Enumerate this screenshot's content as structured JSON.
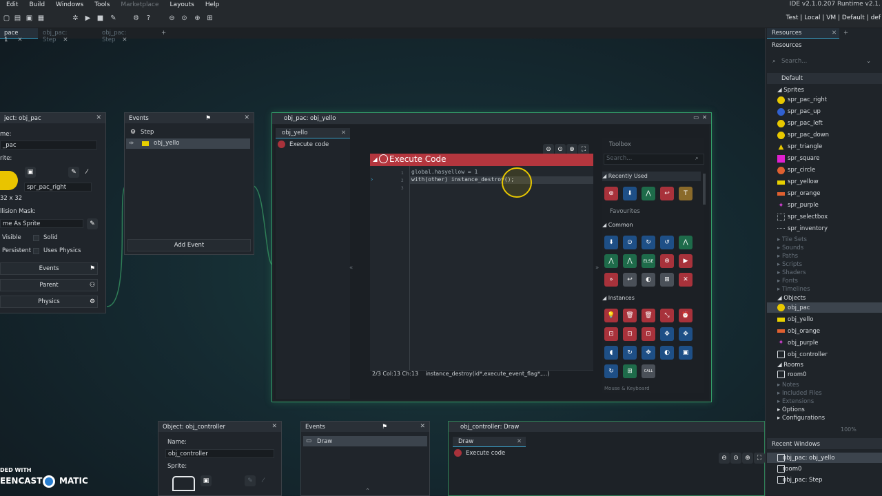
{
  "menubar": {
    "items": [
      "Edit",
      "Build",
      "Windows",
      "Tools",
      "Marketplace",
      "Layouts",
      "Help"
    ],
    "version": "IDE v2.1.0.207 Runtime v2.1."
  },
  "toolbar": {
    "targets": "Test | Local | VM | Default | def"
  },
  "workspace_tabs": [
    {
      "label": "pace 1",
      "state": "active"
    },
    {
      "label": "obj_pac: Step",
      "state": "inactive"
    },
    {
      "label": "obj_pac: Step",
      "state": "inactive"
    }
  ],
  "obj_pac_panel": {
    "title": "ject: obj_pac",
    "name_label": "me:",
    "name_value": "_pac",
    "sprite_label": "rite:",
    "sprite_value": "spr_pac_right",
    "size": "32 x 32",
    "collision_label": "llision Mask:",
    "collision_value": "me As Sprite",
    "visible": "Visible",
    "solid": "Solid",
    "persistent": "Persistent",
    "uses_physics": "Uses Physics",
    "events_btn": "Events",
    "parent_btn": "Parent",
    "physics_btn": "Physics"
  },
  "events_panel": {
    "title": "Events",
    "items": [
      "Step",
      "obj_yello"
    ],
    "add_event": "Add Event"
  },
  "object_window": {
    "title": "obj_pac: obj_yello",
    "tab": "obj_yello",
    "action": "Execute code",
    "code_title": "Execute Code",
    "line1": "global.hasyellow = 1",
    "line2": "with(other) instance_destroy();",
    "line_numbers": [
      "1",
      "2",
      "3"
    ],
    "status_pos": "2/3 Col:13 Ch:13",
    "status_hint": "instance_destroy(id*,execute_event_flag*,...)"
  },
  "toolbox": {
    "title": "Toolbox",
    "search_placeholder": "Search...",
    "recently_used": "Recently Used",
    "favourites": "Favourites",
    "common": "Common",
    "instances": "Instances",
    "mouse_keyboard": "Mouse & Keyboard",
    "else_label": "ELSE"
  },
  "resources": {
    "tab": "Resources",
    "header": "Resources",
    "search_placeholder": "Search...",
    "default": "Default",
    "sprites_label": "Sprites",
    "sprites": [
      "spr_pac_right",
      "spr_pac_up",
      "spr_pac_left",
      "spr_pac_down",
      "spr_triangle",
      "spr_square",
      "spr_circle",
      "spr_yellow",
      "spr_orange",
      "spr_purple",
      "spr_selectbox",
      "spr_inventory"
    ],
    "groups_dim": [
      "Tile Sets",
      "Sounds",
      "Paths",
      "Scripts",
      "Shaders",
      "Fonts",
      "Timelines"
    ],
    "objects_label": "Objects",
    "objects": [
      "obj_pac",
      "obj_yello",
      "obj_orange",
      "obj_purple",
      "obj_controller"
    ],
    "rooms_label": "Rooms",
    "rooms": [
      "room0"
    ],
    "groups_dim2": [
      "Notes",
      "Included Files",
      "Extensions"
    ],
    "options": "Options",
    "configurations": "Configurations",
    "zoom": "100%"
  },
  "recent_windows": {
    "title": "Recent Windows",
    "items": [
      "obj_pac: obj_yello",
      "room0",
      "obj_pac: Step"
    ]
  },
  "controller_panel": {
    "title": "Object: obj_controller",
    "name_label": "Name:",
    "name_value": "obj_controller",
    "sprite_label": "Sprite:"
  },
  "events_panel2": {
    "title": "Events",
    "item": "Draw"
  },
  "draw_window": {
    "title": "obj_controller: Draw",
    "tab": "Draw",
    "action": "Execute code"
  },
  "watermark": {
    "line1": "DED WITH",
    "line2": "EENCAST",
    "line3": "MATIC"
  }
}
